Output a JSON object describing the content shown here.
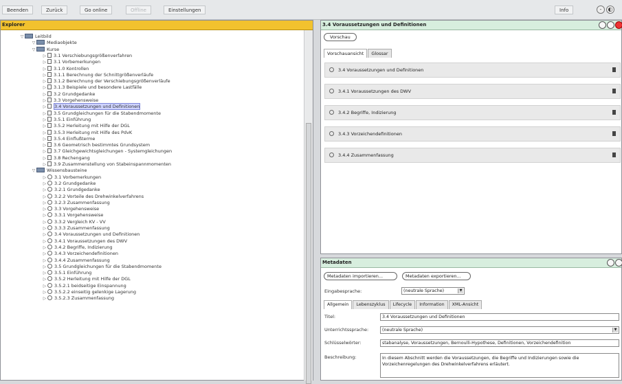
{
  "toolbar": {
    "buttons": [
      "Beenden",
      "Zurück",
      "Go online",
      "Offline",
      "Einstellungen"
    ],
    "info": "Info"
  },
  "explorer": {
    "title": "Explorer",
    "items": [
      {
        "label": "Leitbild",
        "indent": 1
      },
      {
        "label": "Mediaobjekte",
        "indent": 2
      },
      {
        "label": "Kurse",
        "indent": 2
      },
      {
        "label": "3.1 Verschiebungsgrößenverfahren",
        "indent": 3
      },
      {
        "label": "3.1 Vorbemerkungen",
        "indent": 3
      },
      {
        "label": "3.1.0 Kontrollen",
        "indent": 3
      },
      {
        "label": "3.1.1 Berechnung der Schnittgrößenverläufe",
        "indent": 3
      },
      {
        "label": "3.1.2 Berechnung der Verschiebungsgrößenverläufe",
        "indent": 3
      },
      {
        "label": "3.1.3 Beispiele und besondere Lastfälle",
        "indent": 3
      },
      {
        "label": "3.2 Grundgedanke",
        "indent": 3
      },
      {
        "label": "3.3 Vorgehensweise",
        "indent": 3
      },
      {
        "label": "3.4 Voraussetzungen und Definitionen",
        "indent": 3,
        "selected": true
      },
      {
        "label": "3.5 Grundgleichungen für die Stabendmomente",
        "indent": 3
      },
      {
        "label": "3.5.1 Einführung",
        "indent": 3
      },
      {
        "label": "3.5.2 Herleitung mit Hilfe der DGL",
        "indent": 3
      },
      {
        "label": "3.5.3 Herleitung mit Hilfe des PdvK",
        "indent": 3
      },
      {
        "label": "3.5.4 Einflußterme",
        "indent": 3
      },
      {
        "label": "3.6 Geometrisch bestimmtes Grundsystem",
        "indent": 3
      },
      {
        "label": "3.7 Gleichgewichtsgleichungen - Systemgleichungen",
        "indent": 3
      },
      {
        "label": "3.8 Rechengang",
        "indent": 3
      },
      {
        "label": "3.9 Zusammenstellung von Stabeinspannmomenten",
        "indent": 3
      },
      {
        "label": "Wissensbausteine",
        "indent": 2
      },
      {
        "label": "3.1 Vorbemerkungen",
        "indent": 3
      },
      {
        "label": "3.2 Grundgedanke",
        "indent": 3
      },
      {
        "label": "3.2.1 Grundgedanke",
        "indent": 3
      },
      {
        "label": "3.2.2 Vorteile des Drehwinkelverfahrens",
        "indent": 3
      },
      {
        "label": "3.2.3 Zusammenfassung",
        "indent": 3
      },
      {
        "label": "3.3 Vorgehensweise",
        "indent": 3
      },
      {
        "label": "3.3.1 Vorgehensweise",
        "indent": 3
      },
      {
        "label": "3.3.2 Vergleich KV - VV",
        "indent": 3
      },
      {
        "label": "3.3.3 Zusammenfassung",
        "indent": 3
      },
      {
        "label": "3.4 Voraussetzungen und Definitionen",
        "indent": 3
      },
      {
        "label": "3.4.1 Voraussetzungen des DWV",
        "indent": 3
      },
      {
        "label": "3.4.2 Begriffe, Indizierung",
        "indent": 3
      },
      {
        "label": "3.4.3 Vorzeichendefinitionen",
        "indent": 3
      },
      {
        "label": "3.4.4 Zusammenfassung",
        "indent": 3
      },
      {
        "label": "3.5 Grundgleichungen für die Stabendmomente",
        "indent": 3
      },
      {
        "label": "3.5.1 Einführung",
        "indent": 3
      },
      {
        "label": "3.5.2 Herleitung mit Hilfe der DGL",
        "indent": 3
      },
      {
        "label": "3.5.2.1 beidseitige Einspannung",
        "indent": 3
      },
      {
        "label": "3.5.2.2 einseitig gelenkige Lagerung",
        "indent": 3
      },
      {
        "label": "3.5.2.3 Zusammenfassung",
        "indent": 3
      }
    ]
  },
  "content": {
    "title": "3.4 Voraussetzungen und Definitionen",
    "preview_button": "Vorschau",
    "tabs": [
      "Vorschauansicht",
      "Glossar"
    ],
    "sections": [
      "3.4 Voraussetzungen und Definitionen",
      "3.4.1 Voraussetzungen des DWV",
      "3.4.2 Begriffe, Indizierung",
      "3.4.3 Vorzeichendefinitionen",
      "3.4.4 Zusammenfassung"
    ]
  },
  "meta": {
    "title": "Metadaten",
    "import_button": "Metadaten importieren...",
    "export_button": "Metadaten exportieren...",
    "input_lang_label": "Eingabesprache:",
    "input_lang_value": "(neutrale Sprache)",
    "tabs": [
      "Allgemein",
      "Lebenszyklus",
      "Lifecycle",
      "Information",
      "XML-Ansicht"
    ],
    "fields": [
      {
        "label": "Titel:",
        "value": "3.4 Voraussetzungen und Definitionen"
      },
      {
        "label": "Unterrichtssprache:",
        "value": "(neutrale Sprache)"
      },
      {
        "label": "Schlüsselwörter:",
        "value": "stabanalyse, Voraussetzungen, Bernoulli-Hypothese, Definitionen, Vorzeichendefinition"
      },
      {
        "label": "Beschreibung:",
        "value": "In diesem Abschnitt werden die Voraussetzungen, die Begriffe und Indizierungen sowie die Vorzeichenregelungen des Drehwinkelverfahrens erläutert."
      }
    ]
  }
}
